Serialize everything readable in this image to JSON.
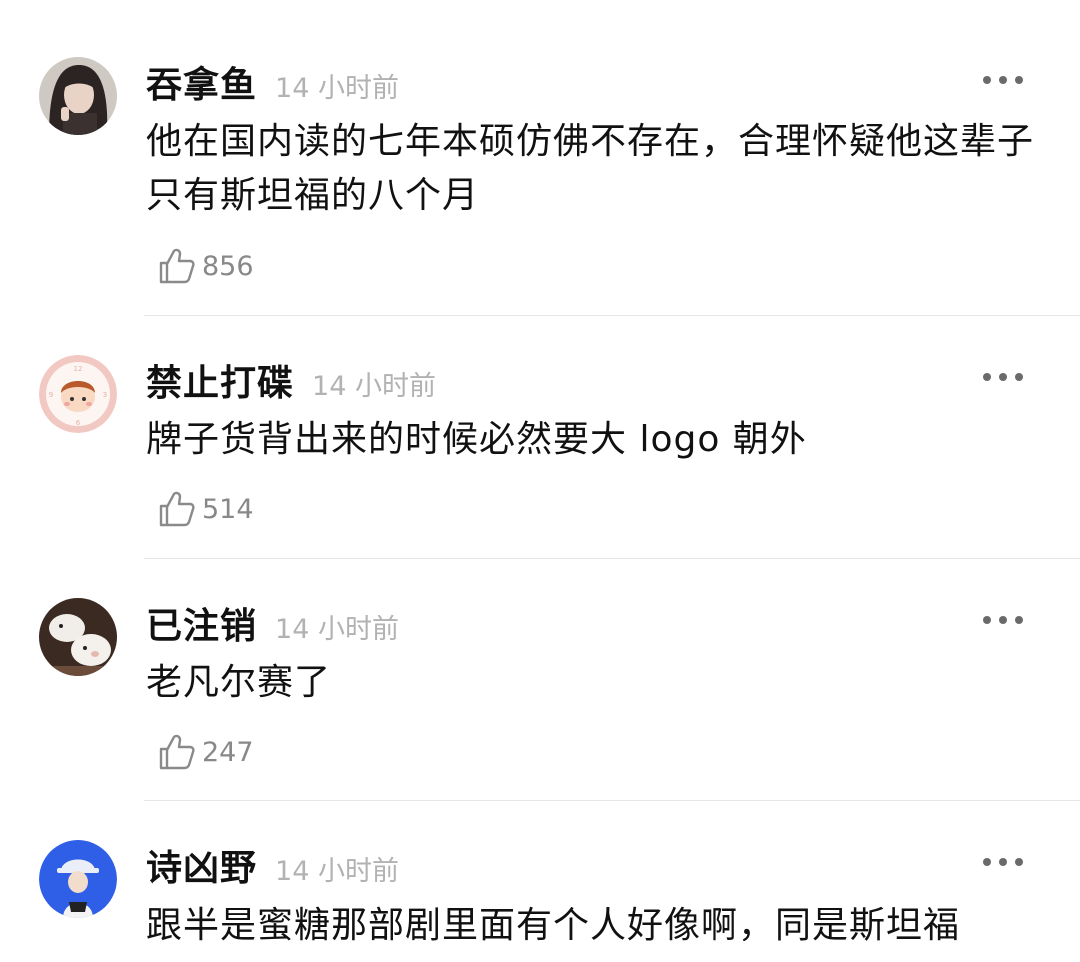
{
  "comments": [
    {
      "username": "吞拿鱼",
      "time": "14 小时前",
      "text": "他在国内读的七年本硕仿佛不存在，合理怀疑他这辈子只有斯坦福的八个月",
      "likes": "856",
      "avatar_icon": "photo-avatar-woman"
    },
    {
      "username": "禁止打碟",
      "time": "14 小时前",
      "text": "牌子货背出来的时候必然要大 logo 朝外",
      "likes": "514",
      "avatar_icon": "cartoon-clock-boy-avatar"
    },
    {
      "username": "已注销",
      "time": "14 小时前",
      "text": "老凡尔赛了",
      "likes": "247",
      "avatar_icon": "lamb-photo-avatar"
    },
    {
      "username": "诗凶野",
      "time": "14 小时前",
      "text": "跟半是蜜糖那部剧里面有个人好像啊，同是斯坦福",
      "likes": "",
      "avatar_icon": "blue-cap-girl-avatar"
    }
  ],
  "icons": {
    "like": "thumbs-up-icon",
    "more": "more-dots-icon"
  },
  "colors": {
    "text": "#111111",
    "meta": "#b2b2b2",
    "count": "#888888",
    "divider": "#e6e6e6"
  }
}
